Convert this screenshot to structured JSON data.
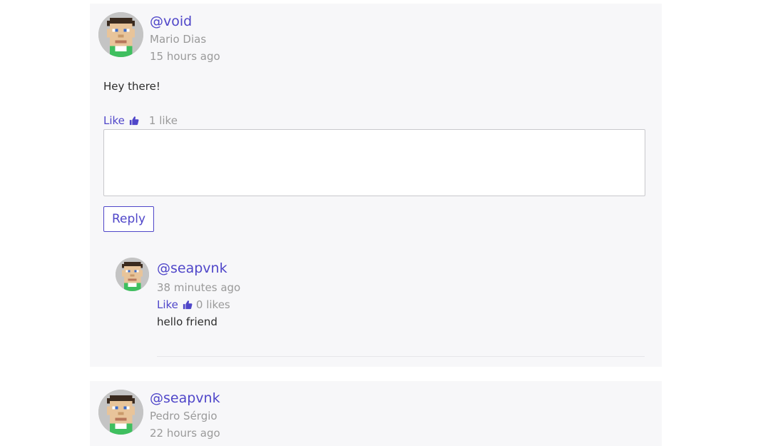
{
  "comments": [
    {
      "username": "@void",
      "real_name": "Mario Dias",
      "timestamp": "15 hours ago",
      "text": "Hey there!",
      "like_label": "Like",
      "like_count": "1 like",
      "reply_label": "Reply",
      "replies": [
        {
          "username": "@seapvnk",
          "timestamp": "38 minutes ago",
          "like_label": "Like",
          "like_count": "0 likes",
          "text": "hello friend"
        }
      ]
    },
    {
      "username": "@seapvnk",
      "real_name": "Pedro Sérgio",
      "timestamp": "22 hours ago"
    }
  ],
  "colors": {
    "accent": "#4f46c9",
    "muted": "#9a9a9a",
    "card_background": "#f7f7f9"
  },
  "icons": {
    "avatar": "pixel-avatar-icon",
    "like": "thumbs-up-icon"
  }
}
